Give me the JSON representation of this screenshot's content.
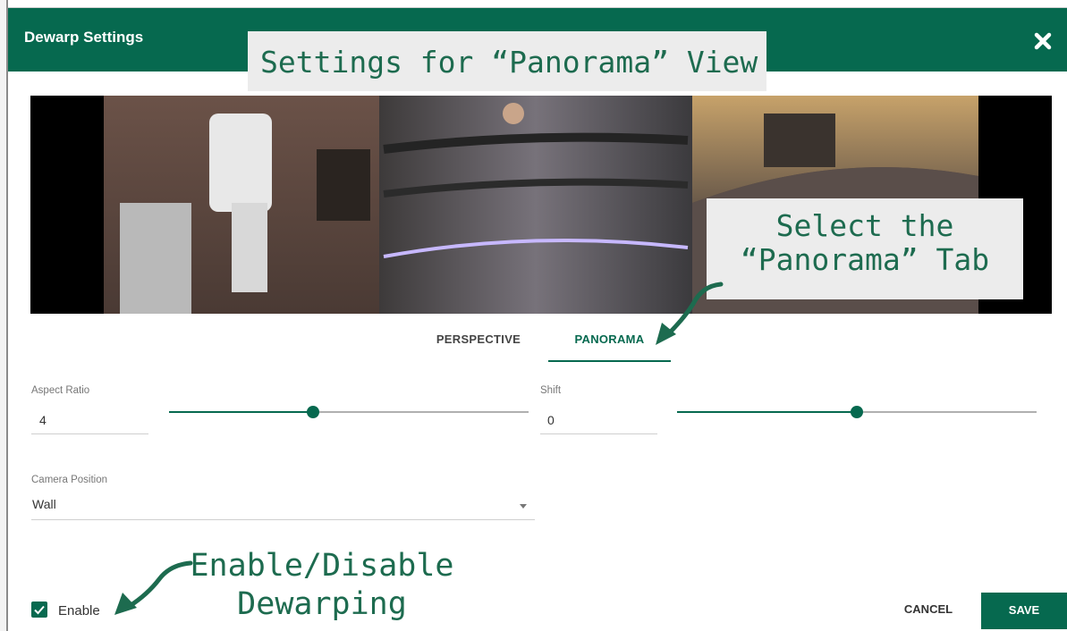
{
  "dialog": {
    "title": "Dewarp Settings",
    "close_icon": "close-x-icon"
  },
  "annotations": {
    "title_callout": "Settings for “Panorama” View",
    "tab_callout_line1": "Select the",
    "tab_callout_line2": "“Panorama” Tab",
    "enable_callout_line1": "Enable/Disable",
    "enable_callout_line2": "Dewarping"
  },
  "tabs": [
    {
      "label": "PERSPECTIVE",
      "active": false
    },
    {
      "label": "PANORAMA",
      "active": true
    }
  ],
  "fields": {
    "aspect_ratio": {
      "label": "Aspect Ratio",
      "value": "4",
      "slider_fraction": 0.4
    },
    "shift": {
      "label": "Shift",
      "value": "0",
      "slider_fraction": 0.5
    },
    "camera_position": {
      "label": "Camera Position",
      "value": "Wall"
    }
  },
  "enable": {
    "label": "Enable",
    "checked": true
  },
  "buttons": {
    "cancel": "CANCEL",
    "save": "SAVE"
  },
  "colors": {
    "brand": "#06694f",
    "annotation": "#1d6b4f",
    "callout_bg": "#ececec"
  }
}
